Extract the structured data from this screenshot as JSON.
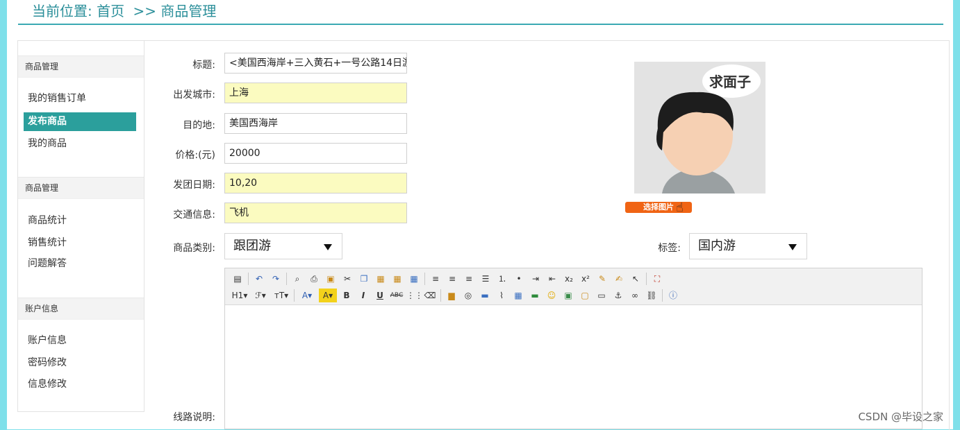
{
  "breadcrumb": {
    "prefix": "当前位置:",
    "home": "首页",
    "separator": ">>",
    "current": "商品管理"
  },
  "sidebar": {
    "sections": [
      {
        "title": "商品管理",
        "items": [
          "我的销售订单",
          "发布商品",
          "我的商品"
        ],
        "active": "发布商品"
      },
      {
        "title": "商品管理",
        "items": [
          "商品统计",
          "销售统计",
          "问题解答"
        ]
      },
      {
        "title": "账户信息",
        "items": [
          "账户信息",
          "密码修改",
          "信息修改"
        ]
      }
    ]
  },
  "form": {
    "title": {
      "label": "标题:",
      "value": "<美国西海岸+三入黄石+一号公路14日游"
    },
    "departure_city": {
      "label": "出发城市:",
      "value": "上海"
    },
    "destination": {
      "label": "目的地:",
      "value": "美国西海岸"
    },
    "price": {
      "label": "价格:(元)",
      "value": "20000"
    },
    "tour_date": {
      "label": "发团日期:",
      "value": "10,20"
    },
    "transport": {
      "label": "交通信息:",
      "value": "飞机"
    },
    "category": {
      "label": "商品类别:",
      "value": "跟团游"
    },
    "tag": {
      "label": "标签:",
      "value": "国内游"
    },
    "route_desc": {
      "label": "线路说明:"
    }
  },
  "avatar": {
    "bubble_text": "求面子",
    "choose_button": "选择图片"
  },
  "editor": {
    "row1": [
      "source",
      "undo",
      "redo",
      "preview",
      "print",
      "template",
      "cut",
      "copy",
      "paste",
      "paste-text",
      "paste-word",
      "align-left",
      "align-center",
      "align-right",
      "justify",
      "ordered-list",
      "unordered-list",
      "indent",
      "outdent",
      "subscript",
      "superscript",
      "clear-format",
      "select-all",
      "select",
      "fullscreen"
    ],
    "row2": [
      "heading",
      "font-family",
      "font-size",
      "font-color",
      "highlight",
      "bold",
      "italic",
      "underline",
      "strikethrough",
      "line-height",
      "remove-format",
      "image-upload",
      "multi-image",
      "flash",
      "attach",
      "table",
      "horizontal-rule",
      "emoticon",
      "image",
      "code",
      "page-break",
      "anchor",
      "link",
      "unlink",
      "help"
    ]
  },
  "watermark": "CSDN @毕设之家",
  "colors": {
    "accent": "#2b9f9c",
    "breadcrumb": "#2b8f9a",
    "yellow_field": "#fbfbc0",
    "button_orange": "#f06414",
    "outer_bg": "#7fe0ea"
  }
}
